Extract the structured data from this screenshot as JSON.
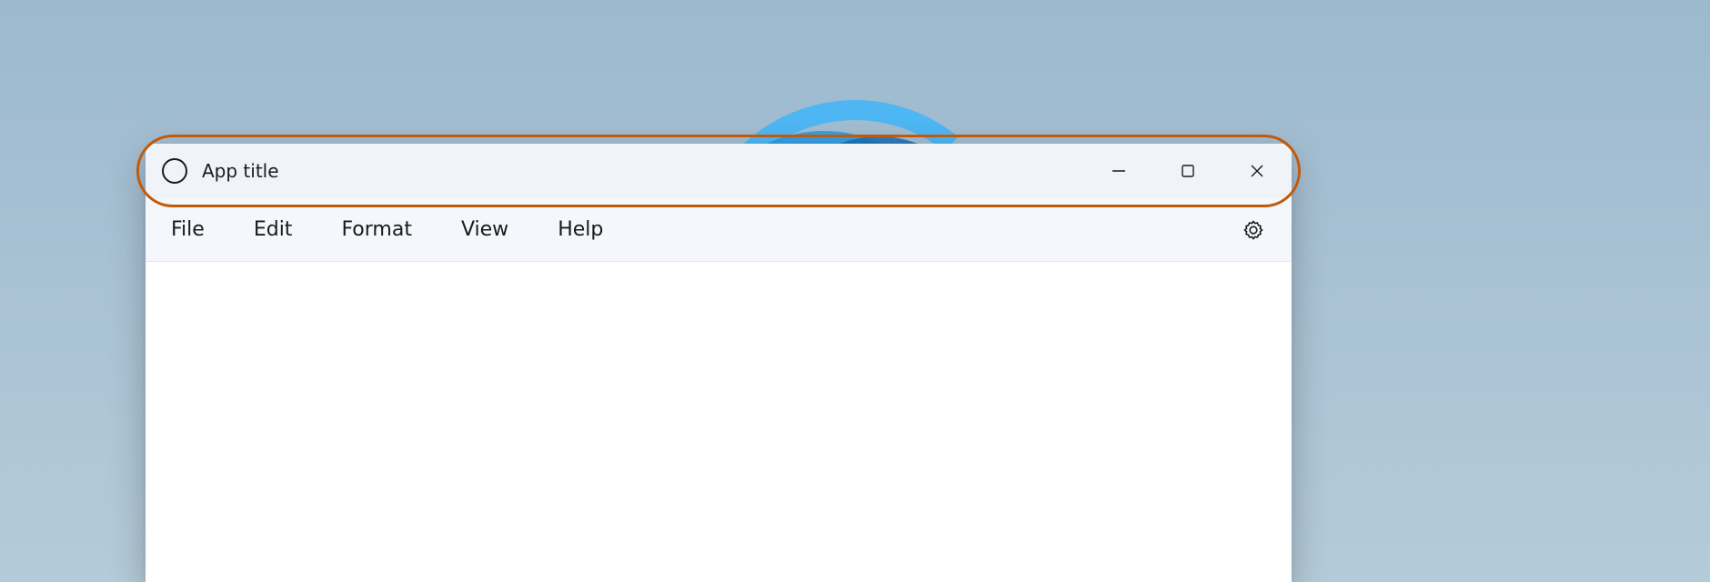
{
  "window": {
    "title": "App title"
  },
  "menubar": {
    "items": [
      "File",
      "Edit",
      "Format",
      "View",
      "Help"
    ]
  },
  "colors": {
    "highlight": "#c15a0a",
    "titlebar_bg": "#f0f4f9",
    "menubar_bg": "#f4f7fb"
  }
}
